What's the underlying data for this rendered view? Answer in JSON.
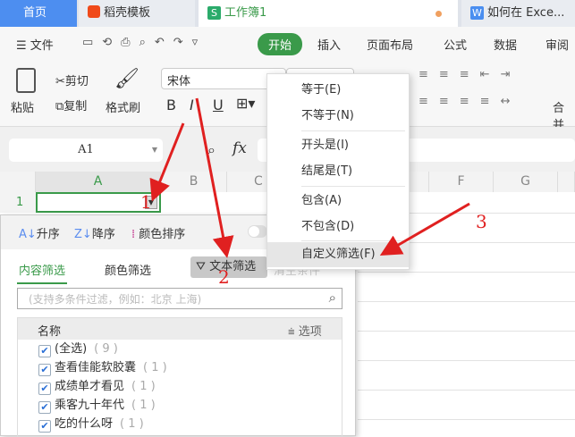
{
  "tabs": [
    {
      "label": "首页"
    },
    {
      "label": "稻壳模板"
    },
    {
      "label": "工作簿1"
    },
    {
      "label": "如何在 Exce..."
    }
  ],
  "menubar": {
    "file": "文件",
    "items": [
      "开始",
      "插入",
      "页面布局",
      "公式",
      "数据",
      "审阅"
    ]
  },
  "ribbon": {
    "paste": "粘贴",
    "cut": "剪切",
    "copy": "复制",
    "format_painter": "格式刷",
    "font": "宋体",
    "bold": "B",
    "italic": "I",
    "underline": "U",
    "merge": "合并"
  },
  "formula_bar": {
    "cell_ref": "A1",
    "fx": "fx"
  },
  "grid": {
    "columns": [
      "A",
      "B",
      "C",
      "F",
      "G"
    ],
    "row1": "1"
  },
  "filter_panel": {
    "sort_asc": "升序",
    "sort_desc": "降序",
    "color_sort": "颜色排序",
    "tab_content": "内容筛选",
    "tab_color": "颜色筛选",
    "text_filter": "文本筛选",
    "clear": "清空条件",
    "search_placeholder": "(支持多条件过滤，例如：北京 上海)",
    "header_name": "名称",
    "options": "选项",
    "items": [
      {
        "label": "(全选)",
        "count": "( 9 )"
      },
      {
        "label": "查看佳能软胶囊",
        "count": "( 1 )"
      },
      {
        "label": "成绩单才看见",
        "count": "( 1 )"
      },
      {
        "label": "乘客九十年代",
        "count": "( 1 )"
      },
      {
        "label": "吃的什么呀",
        "count": "( 1 )"
      }
    ]
  },
  "text_filter_menu": [
    "等于(E)",
    "不等于(N)",
    "开头是(I)",
    "结尾是(T)",
    "包含(A)",
    "不包含(D)",
    "自定义筛选(F)"
  ],
  "annotations": [
    "1",
    "2",
    "3"
  ],
  "colors": {
    "accent": "#3a9a4a",
    "tab_active": "#5b8def",
    "arrow": "#e02020"
  }
}
